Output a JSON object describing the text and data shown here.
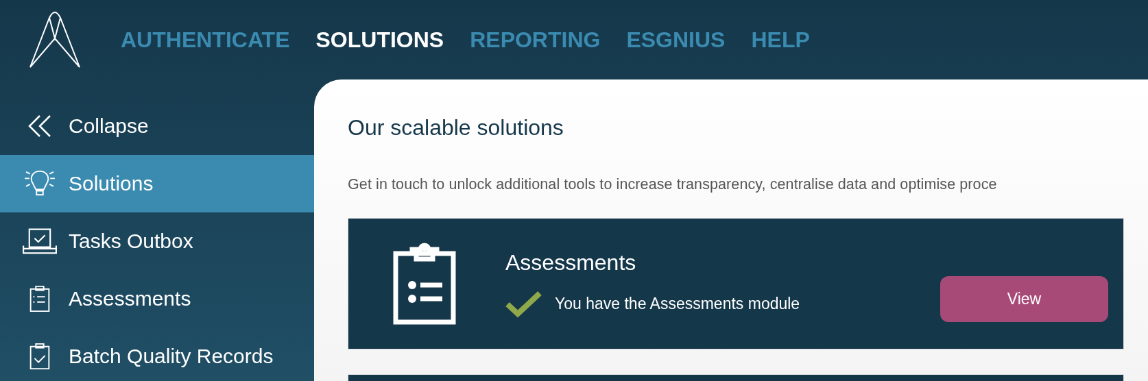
{
  "nav": [
    {
      "label": "AUTHENTICATE",
      "selected": false
    },
    {
      "label": "SOLUTIONS",
      "selected": true
    },
    {
      "label": "REPORTING",
      "selected": false
    },
    {
      "label": "ESGNIUS",
      "selected": false
    },
    {
      "label": "HELP",
      "selected": false
    }
  ],
  "sidebar": {
    "collapse": "Collapse",
    "items": [
      {
        "label": "Solutions",
        "kind": "bulb",
        "selected": true
      },
      {
        "label": "Tasks Outbox",
        "kind": "outbox",
        "selected": false
      },
      {
        "label": "Assessments",
        "kind": "list",
        "selected": false
      },
      {
        "label": "Batch Quality Records",
        "kind": "check",
        "selected": false
      }
    ]
  },
  "main": {
    "title": "Our scalable solutions",
    "subtitle": "Get in touch to unlock additional tools to increase transparency, centralise data and optimise proce",
    "cards": [
      {
        "kind": "module",
        "title": "Assessments",
        "status": "You have the Assessments module",
        "button": "View"
      },
      {
        "kind": "cut"
      }
    ]
  }
}
